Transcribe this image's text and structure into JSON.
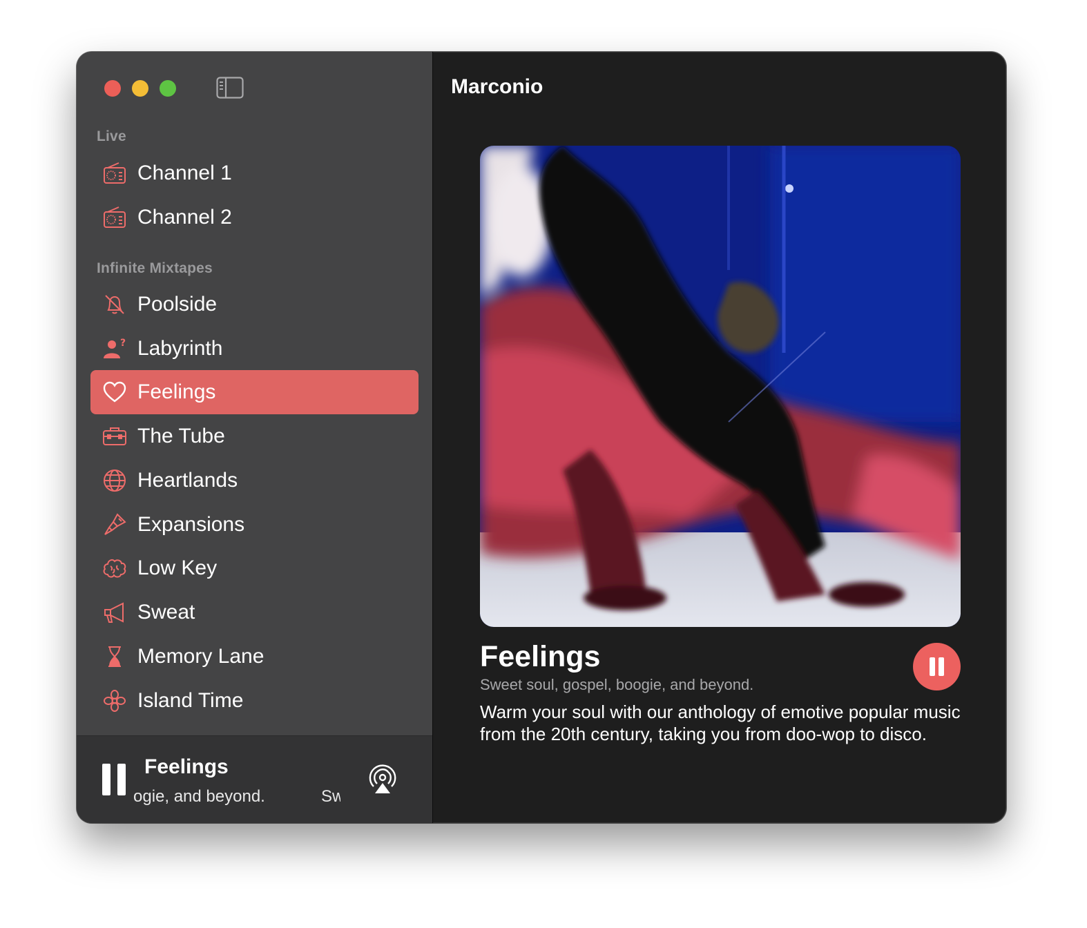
{
  "app": {
    "title": "Marconio"
  },
  "sidebar": {
    "sections": [
      {
        "header": "Live",
        "items": [
          {
            "label": "Channel 1",
            "icon": "radio-icon"
          },
          {
            "label": "Channel 2",
            "icon": "radio-icon"
          }
        ]
      },
      {
        "header": "Infinite Mixtapes",
        "items": [
          {
            "label": "Poolside",
            "icon": "bell-slash-icon"
          },
          {
            "label": "Labyrinth",
            "icon": "person-question-icon"
          },
          {
            "label": "Feelings",
            "icon": "heart-icon",
            "selected": true
          },
          {
            "label": "The Tube",
            "icon": "toolbox-icon"
          },
          {
            "label": "Heartlands",
            "icon": "globe-icon"
          },
          {
            "label": "Expansions",
            "icon": "paintbrush-icon"
          },
          {
            "label": "Low Key",
            "icon": "brain-icon"
          },
          {
            "label": "Sweat",
            "icon": "megaphone-icon"
          },
          {
            "label": "Memory Lane",
            "icon": "hourglass-icon"
          },
          {
            "label": "Island Time",
            "icon": "flower-icon"
          }
        ]
      }
    ]
  },
  "mini_player": {
    "title": "Feelings",
    "marquee_part_1": "ogie, and beyond.",
    "marquee_part_2": "Sw"
  },
  "now_playing": {
    "title": "Feelings",
    "subtitle": "Sweet soul, gospel, boogie, and beyond.",
    "description": "Warm your soul with our anthology of emotive popular music from the 20th century, taking you from doo-wop to disco."
  },
  "colors": {
    "accent": "#ec615f",
    "selected_row": "#df6563",
    "sidebar_bg": "#444445",
    "main_bg": "#1e1e1e"
  }
}
